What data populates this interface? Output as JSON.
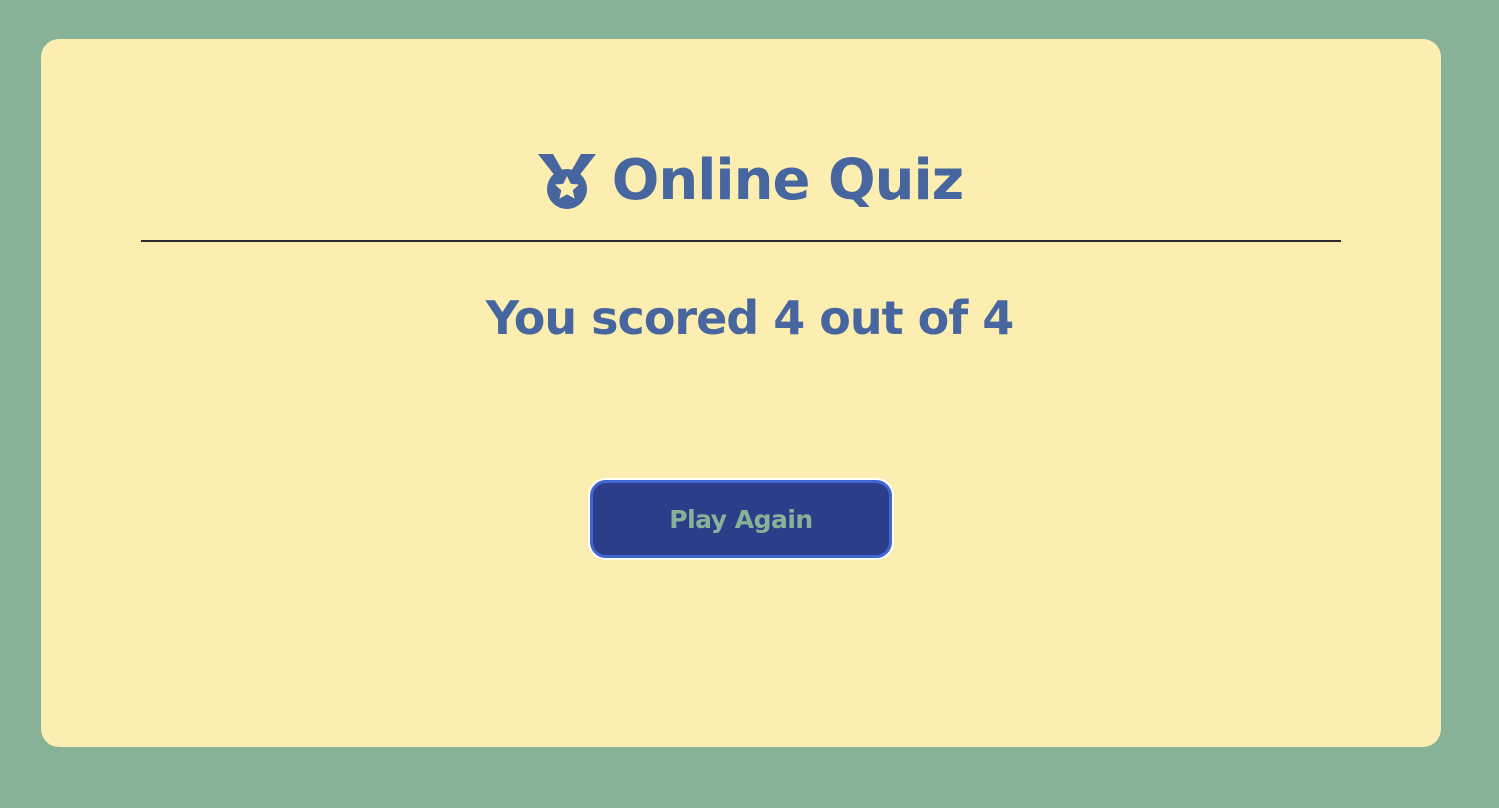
{
  "header": {
    "icon": "medal-icon",
    "title": "Online Quiz"
  },
  "result": {
    "score_text": "You scored 4 out of 4",
    "score": 4,
    "total": 4
  },
  "actions": {
    "play_again_label": "Play Again"
  },
  "colors": {
    "page_background": "#88b297",
    "card_background": "#fceeb0",
    "text_accent": "#4766a0",
    "button_background": "#2c3e8a",
    "button_border": "#3f66d1",
    "button_text": "#88b297"
  }
}
